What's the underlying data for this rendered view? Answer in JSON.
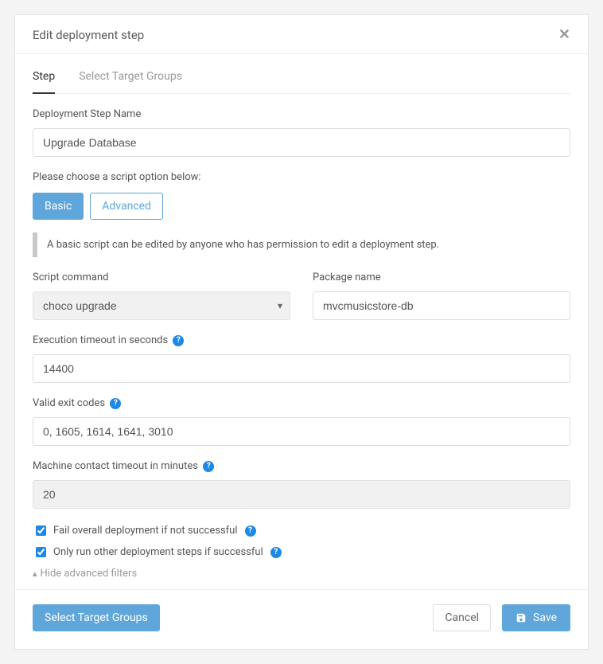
{
  "modal": {
    "title": "Edit deployment step"
  },
  "tabs": {
    "step": "Step",
    "targetGroups": "Select Target Groups"
  },
  "form": {
    "stepNameLabel": "Deployment Step Name",
    "stepNameValue": "Upgrade Database",
    "scriptOptionText": "Please choose a script option below:",
    "basicLabel": "Basic",
    "advancedLabel": "Advanced",
    "basicNotice": "A basic script can be edited by anyone who has permission to edit a deployment step.",
    "scriptCommandLabel": "Script command",
    "scriptCommandValue": "choco upgrade",
    "packageNameLabel": "Package name",
    "packageNameValue": "mvcmusicstore-db",
    "execTimeoutLabel": "Execution timeout in seconds",
    "execTimeoutValue": "14400",
    "validExitCodesLabel": "Valid exit codes",
    "validExitCodesValue": "0, 1605, 1614, 1641, 3010",
    "machineTimeoutLabel": "Machine contact timeout in minutes",
    "machineTimeoutValue": "20",
    "failOverallLabel": "Fail overall deployment if not successful",
    "onlyRunLabel": "Only run other deployment steps if successful",
    "hideFiltersLabel": "Hide advanced filters"
  },
  "footer": {
    "selectTargetGroups": "Select Target Groups",
    "cancel": "Cancel",
    "save": "Save"
  }
}
